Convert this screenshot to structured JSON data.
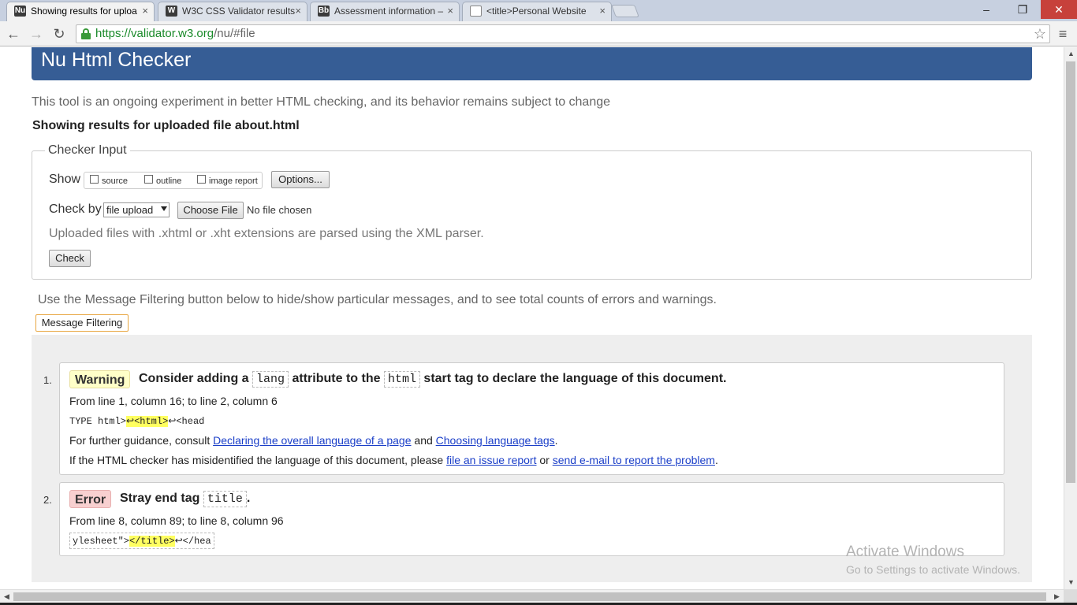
{
  "browser": {
    "tabs": [
      {
        "label": "Showing results for uploa",
        "icon": "nu-favicon",
        "close": "×"
      },
      {
        "label": "W3C CSS Validator results",
        "icon": "w3c-favicon",
        "close": "×"
      },
      {
        "label": "Assessment information –",
        "icon": "blackboard-favicon",
        "close": "×"
      },
      {
        "label": "<title>Personal Website",
        "icon": "page-favicon",
        "close": "×"
      }
    ],
    "tab_icon_text": [
      "Nu",
      "W",
      "Bb",
      ""
    ],
    "window_controls": {
      "minimize": "–",
      "restore": "❐",
      "close": "✕"
    },
    "nav": {
      "back": "←",
      "forward": "→",
      "reload": "↻",
      "star": "☆",
      "menu": "≡"
    },
    "url_scheme_host": "https://validator.w3.org",
    "url_path": "/nu/#file"
  },
  "page": {
    "title": "Nu Html Checker",
    "intro": "This tool is an ongoing experiment in better HTML checking, and its behavior remains subject to change",
    "showing": "Showing results for uploaded file about.html",
    "checker_input": {
      "legend": "Checker Input",
      "show_label": "Show",
      "show_options": [
        "source",
        "outline",
        "image report"
      ],
      "options_button": "Options...",
      "check_by_label": "Check by",
      "check_by_value": "file upload",
      "choose_file_button": "Choose File",
      "no_file": "No file chosen",
      "note": "Uploaded files with .xhtml or .xht extensions are parsed using the XML parser.",
      "check_button": "Check"
    },
    "filter_info": "Use the Message Filtering button below to hide/show particular messages, and to see total counts of errors and warnings.",
    "filter_button": "Message Filtering",
    "messages": [
      {
        "number": "1.",
        "type": "Warning",
        "title_parts": [
          "Consider adding a",
          "lang",
          "attribute to the",
          "html",
          "start tag to declare the language of this document."
        ],
        "location": "From line 1, column 16; to line 2, column 6",
        "extract_before": "TYPE html>",
        "extract_highlight": "↩<html>",
        "extract_after": "↩<head",
        "guidance_prefix": "For further guidance, consult",
        "guidance_link1": "Declaring the overall language of a page",
        "guidance_and": "and",
        "guidance_link2": "Choosing language tags",
        "guidance_end": ".",
        "misid_prefix": "If the HTML checker has misidentified the language of this document, please",
        "misid_link1": "file an issue report",
        "misid_or": "or",
        "misid_link2": "send e-mail to report the problem",
        "misid_end": "."
      },
      {
        "number": "2.",
        "type": "Error",
        "title_parts": [
          "Stray end tag",
          "title",
          "."
        ],
        "location": "From line 8, column 89; to line 8, column 96",
        "extract_before": "ylesheet\">",
        "extract_highlight": "</title>",
        "extract_after": "↩</hea"
      }
    ]
  },
  "watermark": {
    "line1": "Activate Windows",
    "line2": "Go to Settings to activate Windows."
  },
  "scroll": {
    "up": "▲",
    "down": "▼",
    "left": "◀",
    "right": "▶"
  },
  "colors": {
    "banner": "#365d95",
    "warning_bg": "#ffffc8",
    "error_bg": "#f8d0d0",
    "highlight": "#ffff60",
    "link": "#1a3ec8"
  }
}
